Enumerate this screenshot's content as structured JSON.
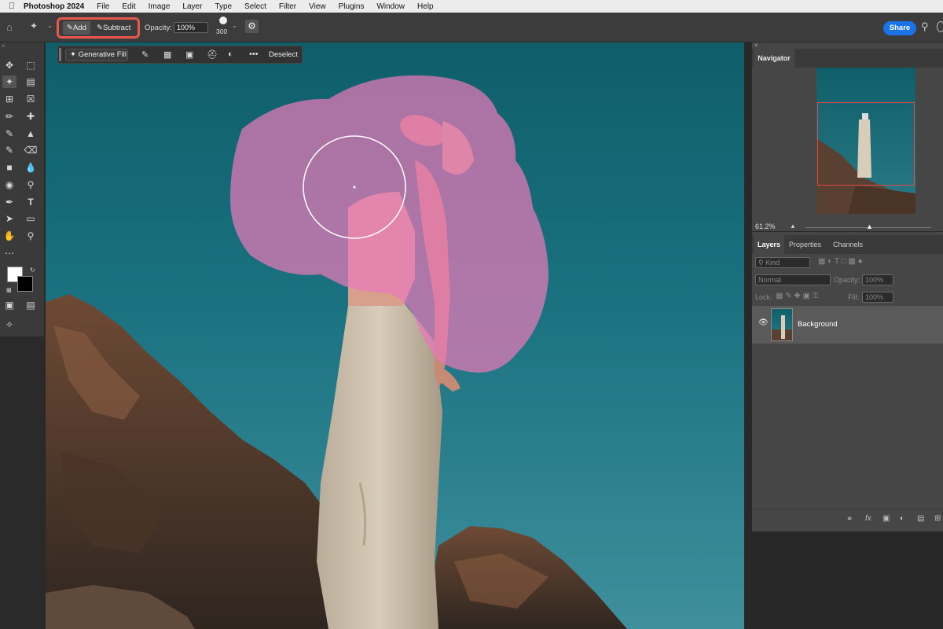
{
  "menubar": {
    "app_name": "Photoshop 2024",
    "items": [
      "File",
      "Edit",
      "Image",
      "Layer",
      "Type",
      "Select",
      "Filter",
      "View",
      "Plugins",
      "Window",
      "Help"
    ]
  },
  "options_bar": {
    "add_label": "Add",
    "subtract_label": "Subtract",
    "opacity_label": "Opacity:",
    "opacity_value": "100%",
    "brush_size": "300",
    "share_label": "Share",
    "highlight_color": "#e8584e"
  },
  "contextual_bar": {
    "generative_fill_label": "Generative Fill",
    "deselect_label": "Deselect",
    "more_label": "•••"
  },
  "navigator": {
    "tab_label": "Navigator",
    "zoom_value": "61.2%"
  },
  "layers_panel": {
    "tabs": [
      "Layers",
      "Properties",
      "Channels"
    ],
    "kind_placeholder": "Kind",
    "blend_mode": "Normal",
    "opacity_label": "Opacity:",
    "opacity_value": "100%",
    "lock_label": "Lock:",
    "fill_label": "Fill:",
    "fill_value": "100%",
    "layer_name": "Background"
  },
  "colors": {
    "selection_overlay": "#e87ab8",
    "share_blue": "#1b73e8",
    "sky": "#1a7280"
  }
}
